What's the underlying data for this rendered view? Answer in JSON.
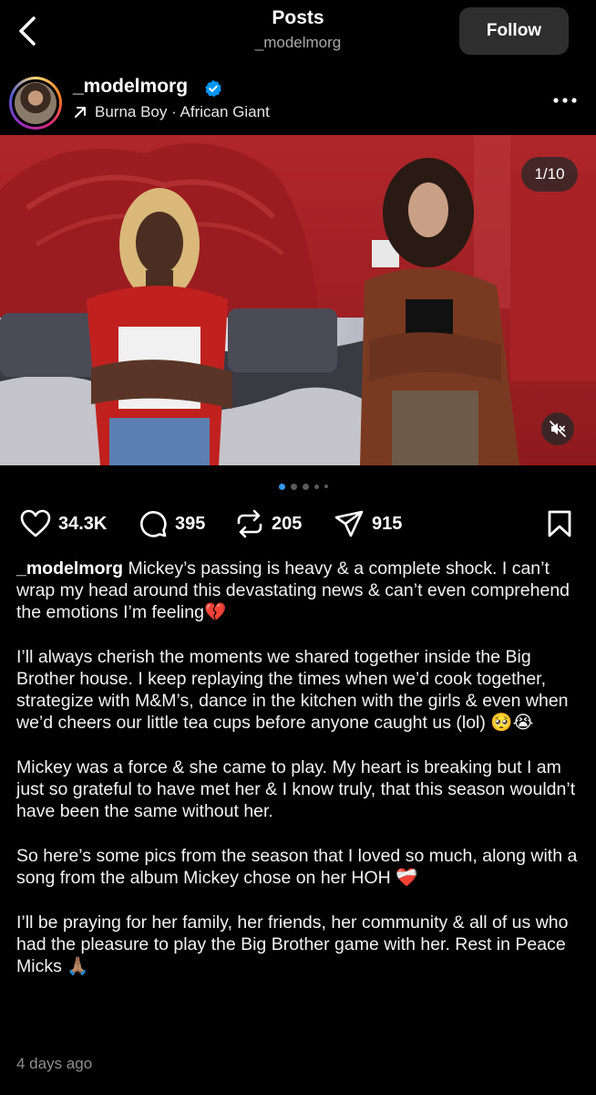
{
  "header": {
    "title": "Posts",
    "subtitle": "_modelmorg",
    "follow_label": "Follow"
  },
  "author": {
    "username": "_modelmorg",
    "verified": true,
    "music": "Burna Boy · African Giant"
  },
  "media": {
    "counter": "1/10",
    "current_index": 1,
    "total": 10,
    "muted": true
  },
  "stats": {
    "likes": "34.3K",
    "comments": "395",
    "reposts": "205",
    "shares": "915"
  },
  "caption": {
    "username": "_modelmorg",
    "paragraphs": [
      "Mickey’s passing is heavy & a complete shock. I can’t wrap my head around this devastating news & can’t even comprehend the emotions I’m feeling💔",
      "I’ll always cherish the moments we shared together inside the Big Brother house. I keep replaying the times when we’d cook together, strategize with M&M’s, dance in the kitchen with the girls & even when we’d cheers our little tea cups before anyone caught us (lol) 🥺😭",
      "Mickey was a force & she came to play. My heart is breaking but I am just so grateful to have met her & I know truly, that this season wouldn’t have been the same without her.",
      "So here’s some pics from the season that I loved so much, along with a song from the album Mickey chose on her HOH ❤️‍🩹",
      "I’ll be praying for her family, her friends, her community & all of us who had the pleasure to play the Big Brother game with her. Rest in Peace Micks 🙏🏽"
    ]
  },
  "timestamp": "4 days ago",
  "colors": {
    "accent": "#3897f0",
    "verified": "#0095f6",
    "background": "#000000",
    "wall": "#a31f22"
  }
}
